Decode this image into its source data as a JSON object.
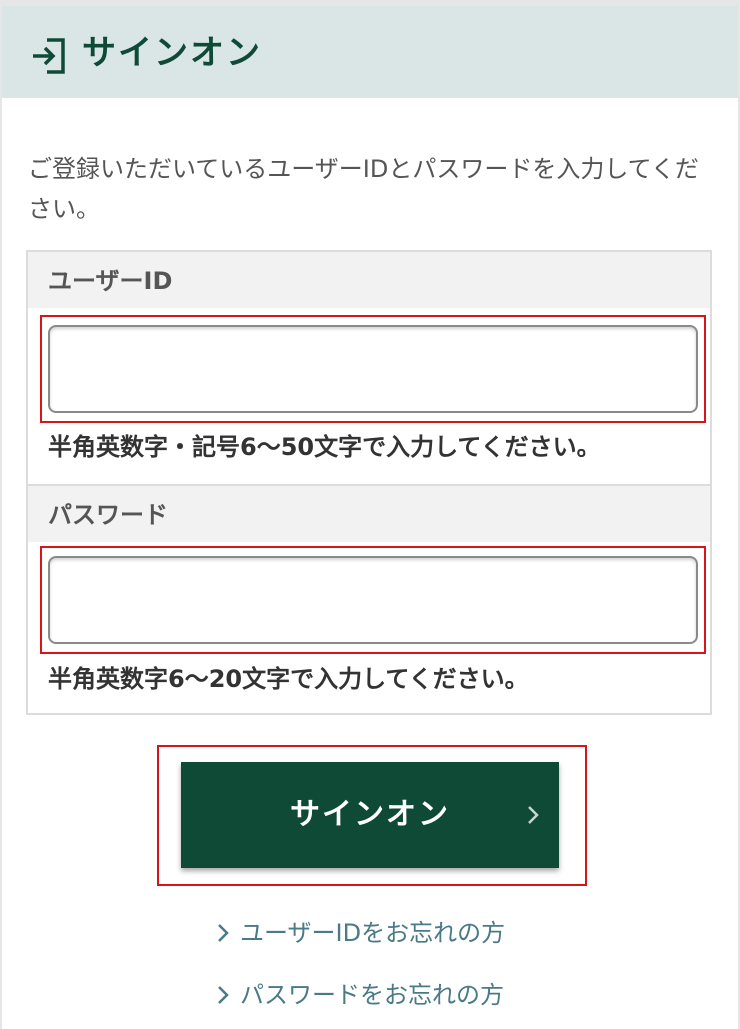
{
  "header": {
    "title": "サインオン",
    "icon": "sign-in-icon"
  },
  "intro": {
    "text": "ご登録いただいているユーザーIDとパスワードを入力してください。"
  },
  "form": {
    "user_id": {
      "label": "ユーザーID",
      "value": "",
      "hint": "半角英数字・記号6〜50文字で入力してください。"
    },
    "password": {
      "label": "パスワード",
      "value": "",
      "hint": "半角英数字6〜20文字で入力してください。"
    }
  },
  "signon_button": {
    "label": "サインオン",
    "icon": "chevron-right-icon"
  },
  "links": {
    "forgot_user_id": "ユーザーIDをお忘れの方",
    "forgot_password": "パスワードをお忘れの方"
  },
  "colors": {
    "brand": "#0e4a36",
    "header_bg": "#d9e6e5",
    "highlight": "#d7141a",
    "link": "#4a7a86"
  }
}
